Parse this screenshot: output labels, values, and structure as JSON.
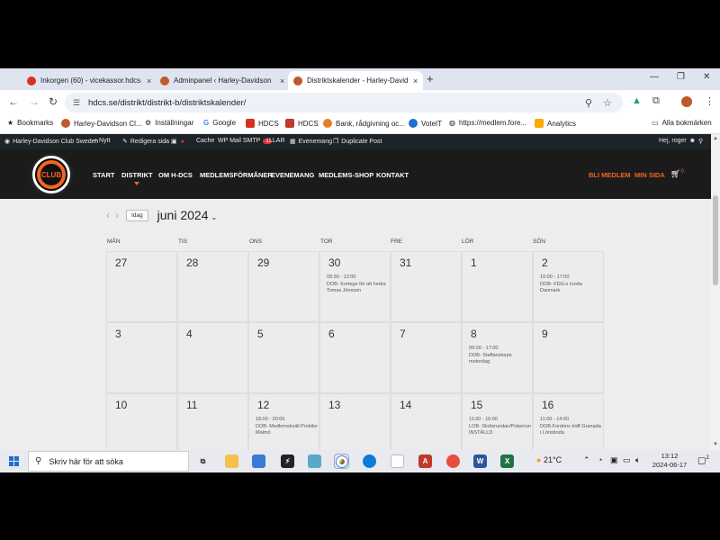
{
  "tabs": [
    {
      "title": "Inkorgen (60) - vicekassor.hdcs@",
      "favicon_color": "#d93025",
      "active": false
    },
    {
      "title": "Adminpanel ‹ Harley-Davidson",
      "favicon_color": "#c0582a",
      "active": false
    },
    {
      "title": "Distriktskalender - Harley-David",
      "favicon_color": "#c0582a",
      "active": true
    }
  ],
  "tab_close": "×",
  "new_tab": "+",
  "window_controls": {
    "minimize": "—",
    "restore": "❐",
    "close": "✕"
  },
  "nav_icons": {
    "back": "←",
    "forward": "→",
    "reload": "↻"
  },
  "address": {
    "url": "hdcs.se/distrikt/distrikt-b/distriktskalender/"
  },
  "omnibox_icons": {
    "zoom": "⚲",
    "star": "☆"
  },
  "toolbar_icons": {
    "drive": "▲",
    "extensions": "⧉",
    "menu": "⋮"
  },
  "bookmarks": [
    {
      "label": "Bookmarks",
      "icon_color": "#444"
    },
    {
      "label": "Harley-Davidson Cl...",
      "icon_color": "#c0582a"
    },
    {
      "label": "Inställningar",
      "icon_color": "#666"
    },
    {
      "label": "Google",
      "icon_color": "#4285f4"
    },
    {
      "label": "HDCS",
      "icon_color": "#d93025"
    },
    {
      "label": "HDCS",
      "icon_color": "#c0392b"
    },
    {
      "label": "Bank, rådgivning oc...",
      "icon_color": "#e67e22"
    },
    {
      "label": "VoteIT",
      "icon_color": "#1f6fd1"
    },
    {
      "label": "https://medlem.fore...",
      "icon_color": "#555"
    },
    {
      "label": "Analytics",
      "icon_color": "#f9ab00"
    }
  ],
  "all_bookmarks": "Alla bokmärken",
  "adminbar": {
    "site": "Harley-Davidson Club Sweden",
    "new": "+ Nytt",
    "edit": "Redigera sida",
    "cache": "Cache",
    "smtp": "WP Mail SMTP",
    "smtp_badge": "1",
    "llar": "LLAR",
    "events": "Evenemang",
    "duplicate": "Duplicate Post",
    "greeting": "Hej, roger"
  },
  "logo": {
    "text": "CLUB"
  },
  "nav": [
    "START",
    "DISTRIKT",
    "OM H-DCS",
    "MEDLEMSFÖRMÅNER",
    "EVENEMANG",
    "MEDLEMS-SHOP",
    "KONTAKT"
  ],
  "cta": {
    "join": "BLI MEDLEM",
    "mypage": "MIN SIDA",
    "cart_count": "0"
  },
  "calendar": {
    "prev": "‹",
    "next": "›",
    "today_button": "Idag",
    "month_title": "juni 2024",
    "weekdays": [
      "MÅN",
      "TIS",
      "ONS",
      "TOR",
      "FRE",
      "LÖR",
      "SÖN"
    ],
    "weeks": [
      [
        {
          "day": "27",
          "events": []
        },
        {
          "day": "28",
          "events": []
        },
        {
          "day": "29",
          "events": []
        },
        {
          "day": "30",
          "events": [
            "09:30 - 12:00",
            "DOB- Kortege för att hedra Tomas Jönsson"
          ]
        },
        {
          "day": "31",
          "events": []
        },
        {
          "day": "1",
          "events": []
        },
        {
          "day": "2",
          "events": [
            "10:00 - 17:00",
            "DOB- FDG:s runda Danmark"
          ]
        }
      ],
      [
        {
          "day": "3",
          "events": []
        },
        {
          "day": "4",
          "events": []
        },
        {
          "day": "5",
          "events": []
        },
        {
          "day": "6",
          "events": []
        },
        {
          "day": "7",
          "events": []
        },
        {
          "day": "8",
          "events": [
            "09:00 - 17:00",
            "DOB- Staffanstorps motordag"
          ]
        },
        {
          "day": "9",
          "events": []
        }
      ],
      [
        {
          "day": "10",
          "events": []
        },
        {
          "day": "11",
          "events": []
        },
        {
          "day": "12",
          "events": [
            "18:00 - 20:00",
            "DOB- Medlemskväll Probike Malmö"
          ]
        },
        {
          "day": "13",
          "events": []
        },
        {
          "day": "14",
          "events": []
        },
        {
          "day": "15",
          "events": [
            "11:00 - 16:00",
            "LOB- Slottsrundan/Pokerrun",
            "INSTÄLLD"
          ]
        },
        {
          "day": "16",
          "events": [
            "11:00 - 14:00",
            "DOB-Fordons träff Granada i Lönsboda"
          ]
        }
      ]
    ]
  },
  "taskbar": {
    "search_placeholder": "Skriv här för att söka",
    "weather": "21°C",
    "time": "13:12",
    "date": "2024-06-17",
    "notifications": "2"
  }
}
